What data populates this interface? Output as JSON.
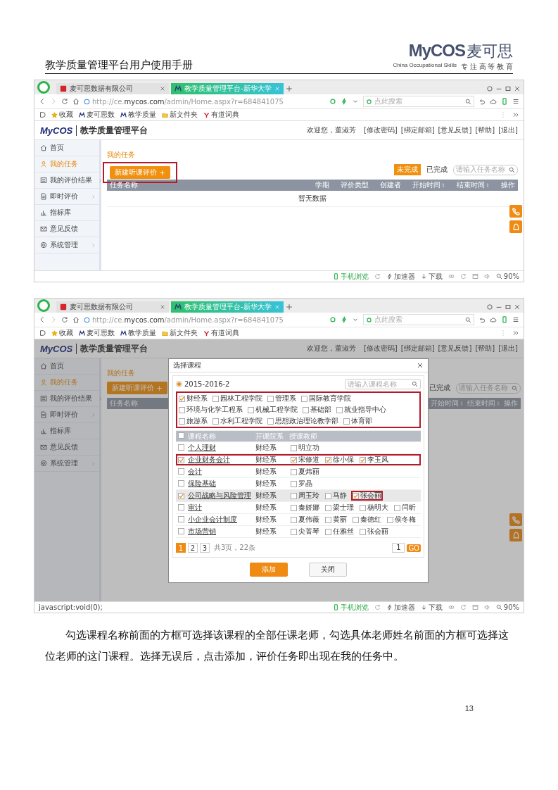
{
  "document": {
    "title": "教学质量管理平台用户使用手册",
    "logo": {
      "brand": "MyCOS",
      "name": "麦可思",
      "tagline": "China Occupational Skills",
      "motto": "专 注 高 等 教 育"
    }
  },
  "screenshots": [
    {
      "browser": {
        "tabs": [
          {
            "label": "麦可思数据有限公司",
            "selected": false
          },
          {
            "label": "教学质量管理平台-新华大学",
            "selected": true
          }
        ],
        "address": "http://ce.**mycos.com**/admin/Home.aspx?r=684841075",
        "search": {
          "placeholder": "点此搜索"
        },
        "bookmarks": [
          {
            "label": "收藏",
            "kind": "star"
          },
          {
            "label": "麦可思数",
            "kind": "logo"
          },
          {
            "label": "教学质量",
            "kind": "logo"
          },
          {
            "label": "新文件夹",
            "kind": "folder"
          },
          {
            "label": "有道词典",
            "kind": "dict"
          }
        ]
      },
      "app": {
        "logo": "MyCOS",
        "title": "教学质量管理平台",
        "user": "欢迎您，董淑芳",
        "links": [
          "[修改密码]",
          "[绑定邮箱]",
          "[意见反馈]",
          "[帮助]",
          "[退出]"
        ],
        "sidebar": [
          {
            "label": "首页",
            "kind": "home",
            "selected": false,
            "expandable": false
          },
          {
            "label": "我的任务",
            "kind": "user",
            "selected": true,
            "expandable": false
          },
          {
            "label": "我的评价结果",
            "kind": "list",
            "selected": false,
            "expandable": true
          },
          {
            "label": "即时评价",
            "kind": "doc",
            "selected": false,
            "expandable": true
          },
          {
            "label": "指标库",
            "kind": "chart",
            "selected": false,
            "expandable": false
          },
          {
            "label": "意见反馈",
            "kind": "mail",
            "selected": false,
            "expandable": false
          },
          {
            "label": "系统管理",
            "kind": "gear",
            "selected": false,
            "expandable": true
          }
        ],
        "page_title": "我的任务",
        "new_button": {
          "label": "新建听课评价",
          "highlighted": true
        },
        "tabs": [
          {
            "label": "未完成",
            "selected": true
          },
          {
            "label": "已完成",
            "selected": false
          }
        ],
        "search": {
          "placeholder": "请输入任务名称"
        },
        "columns": [
          {
            "label": "任务名称",
            "sortable": false
          },
          {
            "label": "学期",
            "sortable": false
          },
          {
            "label": "评价类型",
            "sortable": false
          },
          {
            "label": "创建者",
            "sortable": false
          },
          {
            "label": "开始时间",
            "sortable": true
          },
          {
            "label": "结束时间",
            "sortable": true
          },
          {
            "label": "操作",
            "sortable": false
          }
        ],
        "empty_text": "暂无数据"
      },
      "status_bar": {
        "items": [
          {
            "kind": "mobile",
            "label": "手机浏览"
          },
          {
            "kind": "refresh"
          },
          {
            "kind": "accel",
            "label": "加速器"
          },
          {
            "kind": "download",
            "label": "下载"
          },
          {
            "kind": "link"
          },
          {
            "kind": "refresh"
          },
          {
            "kind": "window"
          },
          {
            "kind": "sound"
          },
          {
            "kind": "zoom",
            "label": "90%"
          }
        ]
      }
    },
    {
      "browser": {
        "tabs": [
          {
            "label": "麦可思数据有限公司",
            "selected": false
          },
          {
            "label": "教学质量管理平台-新华大学",
            "selected": true
          }
        ],
        "address": "http://ce.**mycos.com**/admin/Home.aspx?r=684841075",
        "search": {
          "placeholder": "点此搜索"
        },
        "bookmarks": [
          {
            "label": "收藏",
            "kind": "star"
          },
          {
            "label": "麦可思数",
            "kind": "logo"
          },
          {
            "label": "教学质量",
            "kind": "logo"
          },
          {
            "label": "新文件夹",
            "kind": "folder"
          },
          {
            "label": "有道词典",
            "kind": "dict"
          }
        ]
      },
      "app": {
        "logo": "MyCOS",
        "title": "教学质量管理平台",
        "user": "欢迎您，董淑芳",
        "links": [
          "[修改密码]",
          "[绑定邮箱]",
          "[意见反馈]",
          "[帮助]",
          "[退出]"
        ],
        "sidebar": [
          {
            "label": "首页",
            "kind": "home",
            "selected": false,
            "expandable": false
          },
          {
            "label": "我的任务",
            "kind": "user",
            "selected": true,
            "expandable": false
          },
          {
            "label": "我的评价结果",
            "kind": "list",
            "selected": false,
            "expandable": true
          },
          {
            "label": "即时评价",
            "kind": "doc",
            "selected": false,
            "expandable": true
          },
          {
            "label": "指标库",
            "kind": "chart",
            "selected": false,
            "expandable": false
          },
          {
            "label": "意见反馈",
            "kind": "mail",
            "selected": false,
            "expandable": false
          },
          {
            "label": "系统管理",
            "kind": "gear",
            "selected": false,
            "expandable": true
          }
        ],
        "page_title": "我的任务",
        "new_button": {
          "label": "新建听课评价",
          "highlighted": false
        },
        "tabs": [
          {
            "label": "已完成",
            "selected": false
          }
        ],
        "search": {
          "placeholder": "请输入任务名称"
        },
        "columns": [
          {
            "label": "任务名称",
            "sortable": false
          },
          {
            "label": "开始时间",
            "sortable": true
          },
          {
            "label": "结束时间",
            "sortable": true
          },
          {
            "label": "操作",
            "sortable": false
          }
        ]
      },
      "dialog": {
        "title": "选择课程",
        "semester": {
          "label": "2015-2016-2",
          "selected": true
        },
        "search": {
          "placeholder": "请输入课程名称"
        },
        "departments_highlighted": true,
        "departments": [
          {
            "label": "财经系",
            "checked": true
          },
          {
            "label": "园林工程学院",
            "checked": false
          },
          {
            "label": "管理系",
            "checked": false
          },
          {
            "label": "国际教育学院",
            "checked": false
          },
          {
            "label": "环境与化学工程系",
            "checked": false
          },
          {
            "label": "机械工程学院",
            "checked": false
          },
          {
            "label": "基础部",
            "checked": false
          },
          {
            "label": "就业指导中心",
            "checked": false
          },
          {
            "label": "旅游系",
            "checked": false
          },
          {
            "label": "水利工程学院",
            "checked": false
          },
          {
            "label": "思想政治理论教学部",
            "checked": false
          },
          {
            "label": "体育部",
            "checked": false
          }
        ],
        "select_all_checked": false,
        "columns": [
          "课程名称",
          "开课院系",
          "授课教师"
        ],
        "rows": [
          {
            "course": "个人理财",
            "checked": false,
            "department": "财经系",
            "highlighted": false,
            "hovered": false,
            "teachers": [
              {
                "name": "明立功",
                "checked": false,
                "highlighted": false
              }
            ]
          },
          {
            "course": "企业财务会计",
            "checked": true,
            "department": "财经系",
            "highlighted": true,
            "hovered": false,
            "teachers": [
              {
                "name": "宋修道",
                "checked": true,
                "highlighted": false
              },
              {
                "name": "徐小保",
                "checked": true,
                "highlighted": false
              },
              {
                "name": "李玉凤",
                "checked": true,
                "highlighted": false
              }
            ]
          },
          {
            "course": "会计",
            "checked": false,
            "department": "财经系",
            "highlighted": false,
            "hovered": false,
            "teachers": [
              {
                "name": "夏炜丽",
                "checked": false,
                "highlighted": false
              }
            ]
          },
          {
            "course": "保险基础",
            "checked": false,
            "department": "财经系",
            "highlighted": false,
            "hovered": false,
            "teachers": [
              {
                "name": "罗晶",
                "checked": false,
                "highlighted": false
              }
            ]
          },
          {
            "course": "公司战略与风险管理",
            "checked": true,
            "department": "财经系",
            "highlighted": false,
            "hovered": true,
            "teachers": [
              {
                "name": "周玉玲",
                "checked": false,
                "highlighted": false
              },
              {
                "name": "马静",
                "checked": false,
                "highlighted": false
              },
              {
                "name": "张会丽",
                "checked": true,
                "highlighted": true
              }
            ]
          },
          {
            "course": "审计",
            "checked": false,
            "department": "财经系",
            "highlighted": false,
            "hovered": false,
            "teachers": [
              {
                "name": "秦娇娜",
                "checked": false,
                "highlighted": false
              },
              {
                "name": "梁士璟",
                "checked": false,
                "highlighted": false
              },
              {
                "name": "杨明大",
                "checked": false,
                "highlighted": false
              },
              {
                "name": "闫昕",
                "checked": false,
                "highlighted": false
              }
            ]
          },
          {
            "course": "小企业会计制度",
            "checked": false,
            "department": "财经系",
            "highlighted": false,
            "hovered": false,
            "teachers": [
              {
                "name": "夏伟薇",
                "checked": false,
                "highlighted": false
              },
              {
                "name": "黄丽",
                "checked": false,
                "highlighted": false
              },
              {
                "name": "秦德红",
                "checked": false,
                "highlighted": false
              },
              {
                "name": "侯冬梅",
                "checked": false,
                "highlighted": false
              }
            ]
          },
          {
            "course": "市场营销",
            "checked": false,
            "department": "财经系",
            "highlighted": false,
            "hovered": false,
            "teachers": [
              {
                "name": "尖菁琴",
                "checked": false,
                "highlighted": false
              },
              {
                "name": "任雅丝",
                "checked": false,
                "highlighted": false
              },
              {
                "name": "张会丽",
                "checked": false,
                "highlighted": false
              }
            ]
          }
        ],
        "pagination": {
          "pages": [
            {
              "label": "1",
              "selected": true
            },
            {
              "label": "2",
              "selected": false
            },
            {
              "label": "3",
              "selected": false
            }
          ],
          "summary": "共3页，22条",
          "page_input": "1",
          "go": "GO"
        },
        "buttons": [
          {
            "label": "添加",
            "kind": "primary"
          },
          {
            "label": "关闭",
            "kind": "secondary"
          }
        ]
      },
      "status_bar": {
        "left": "javascript:void(0);",
        "items": [
          {
            "kind": "mobile",
            "label": "手机浏览"
          },
          {
            "kind": "refresh"
          },
          {
            "kind": "accel",
            "label": "加速器"
          },
          {
            "kind": "download",
            "label": "下载"
          },
          {
            "kind": "link"
          },
          {
            "kind": "refresh"
          },
          {
            "kind": "window"
          },
          {
            "kind": "sound"
          },
          {
            "kind": "zoom",
            "label": "90%"
          }
        ]
      }
    }
  ],
  "paragraph": "勾选课程名称前面的方框可选择该课程的全部任课老师，勾选具体老师姓名前面的方框可选择这位老师的这门课程。选择无误后，点击添加，评价任务即出现在我的任务中。",
  "page_number": "13"
}
